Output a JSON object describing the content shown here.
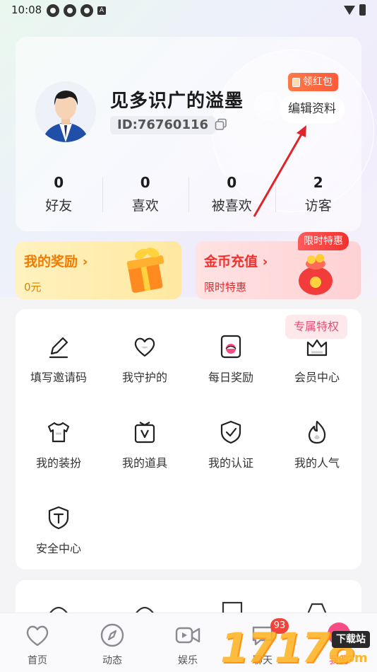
{
  "status_bar": {
    "time": "10:08"
  },
  "profile": {
    "username": "见多识广的溢墨",
    "id_text": "ID:76760116",
    "red_packet_label": "领红包",
    "edit_label": "编辑资料"
  },
  "stats": [
    {
      "value": "0",
      "label": "好友"
    },
    {
      "value": "0",
      "label": "喜欢"
    },
    {
      "value": "0",
      "label": "被喜欢"
    },
    {
      "value": "2",
      "label": "访客"
    }
  ],
  "promo": {
    "rewards_title": "我的奖励 ›",
    "rewards_sub": "0元",
    "coins_title": "金币充值 ›",
    "coins_sub": "限时特惠",
    "limited_tag": "限时特惠"
  },
  "grid": {
    "vip_tag": "专属特权",
    "items": [
      {
        "label": "填写邀请码",
        "icon": "pencil-icon"
      },
      {
        "label": "我守护的",
        "icon": "heart-icon"
      },
      {
        "label": "每日奖励",
        "icon": "reward-card-icon"
      },
      {
        "label": "会员中心",
        "icon": "crown-icon"
      },
      {
        "label": "我的装扮",
        "icon": "tshirt-icon"
      },
      {
        "label": "我的道具",
        "icon": "box-icon"
      },
      {
        "label": "我的认证",
        "icon": "shield-check-icon"
      },
      {
        "label": "我的人气",
        "icon": "flame-icon"
      },
      {
        "label": "安全中心",
        "icon": "shield-t-icon"
      }
    ]
  },
  "nav": {
    "items": [
      {
        "label": "首页",
        "icon": "heart-outline-icon"
      },
      {
        "label": "动态",
        "icon": "compass-icon"
      },
      {
        "label": "娱乐",
        "icon": "video-icon"
      },
      {
        "label": "聊天",
        "icon": "chat-icon"
      },
      {
        "label": "我的",
        "icon": "me-icon"
      }
    ],
    "chat_badge": "93"
  },
  "watermark": {
    "text": "17178",
    "download": "下载站",
    "domain": ".com"
  },
  "colors": {
    "accent_orange": "#f27b00",
    "accent_red": "#f0322f",
    "vip_pink": "#e84d72"
  }
}
